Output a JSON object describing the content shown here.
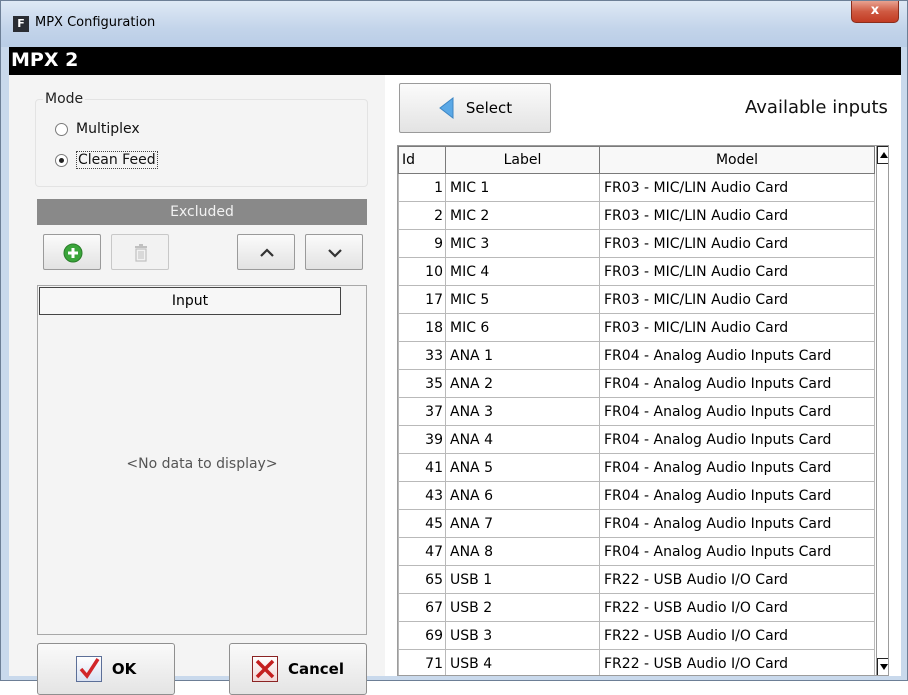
{
  "window": {
    "title": "MPX Configuration",
    "app_icon_letter": "F",
    "close_glyph": "x"
  },
  "header": {
    "title": "MPX 2"
  },
  "mode": {
    "legend": "Mode",
    "options": [
      {
        "label": "Multiplex",
        "checked": false
      },
      {
        "label": "Clean Feed",
        "checked": true
      }
    ]
  },
  "excluded": {
    "header": "Excluded",
    "column_header": "Input",
    "empty_text": "<No data to display>",
    "toolbar_icons": [
      "add-icon",
      "delete-icon",
      "move-up-icon",
      "move-down-icon"
    ]
  },
  "buttons": {
    "ok_label": "OK",
    "cancel_label": "Cancel",
    "select_label": "Select"
  },
  "available": {
    "title": "Available inputs",
    "columns": [
      "Id",
      "Label",
      "Model"
    ],
    "rows": [
      {
        "id": "1",
        "label": "MIC 1",
        "model": "FR03 - MIC/LIN Audio Card"
      },
      {
        "id": "2",
        "label": "MIC 2",
        "model": "FR03 - MIC/LIN Audio Card"
      },
      {
        "id": "9",
        "label": "MIC 3",
        "model": "FR03 - MIC/LIN Audio Card"
      },
      {
        "id": "10",
        "label": "MIC 4",
        "model": "FR03 - MIC/LIN Audio Card"
      },
      {
        "id": "17",
        "label": "MIC 5",
        "model": "FR03 - MIC/LIN Audio Card"
      },
      {
        "id": "18",
        "label": "MIC 6",
        "model": "FR03 - MIC/LIN Audio Card"
      },
      {
        "id": "33",
        "label": "ANA 1",
        "model": "FR04 - Analog Audio Inputs Card"
      },
      {
        "id": "35",
        "label": "ANA 2",
        "model": "FR04 - Analog Audio Inputs Card"
      },
      {
        "id": "37",
        "label": "ANA 3",
        "model": "FR04 - Analog Audio Inputs Card"
      },
      {
        "id": "39",
        "label": "ANA 4",
        "model": "FR04 - Analog Audio Inputs Card"
      },
      {
        "id": "41",
        "label": "ANA 5",
        "model": "FR04 - Analog Audio Inputs Card"
      },
      {
        "id": "43",
        "label": "ANA 6",
        "model": "FR04 - Analog Audio Inputs Card"
      },
      {
        "id": "45",
        "label": "ANA 7",
        "model": "FR04 - Analog Audio Inputs Card"
      },
      {
        "id": "47",
        "label": "ANA 8",
        "model": "FR04 - Analog Audio Inputs Card"
      },
      {
        "id": "65",
        "label": "USB 1",
        "model": "FR22 - USB Audio I/O Card"
      },
      {
        "id": "67",
        "label": "USB 2",
        "model": "FR22 - USB Audio I/O Card"
      },
      {
        "id": "69",
        "label": "USB 3",
        "model": "FR22 - USB Audio I/O Card"
      },
      {
        "id": "71",
        "label": "USB 4",
        "model": "FR22 - USB Audio I/O Card"
      }
    ]
  },
  "colors": {
    "header_bar": "#000000",
    "excluded_header": "#898989",
    "ok_check": "#d2262a",
    "cancel_x": "#c41f1f",
    "add_green": "#3aa53a",
    "select_arrow": "#5aa8e6"
  }
}
